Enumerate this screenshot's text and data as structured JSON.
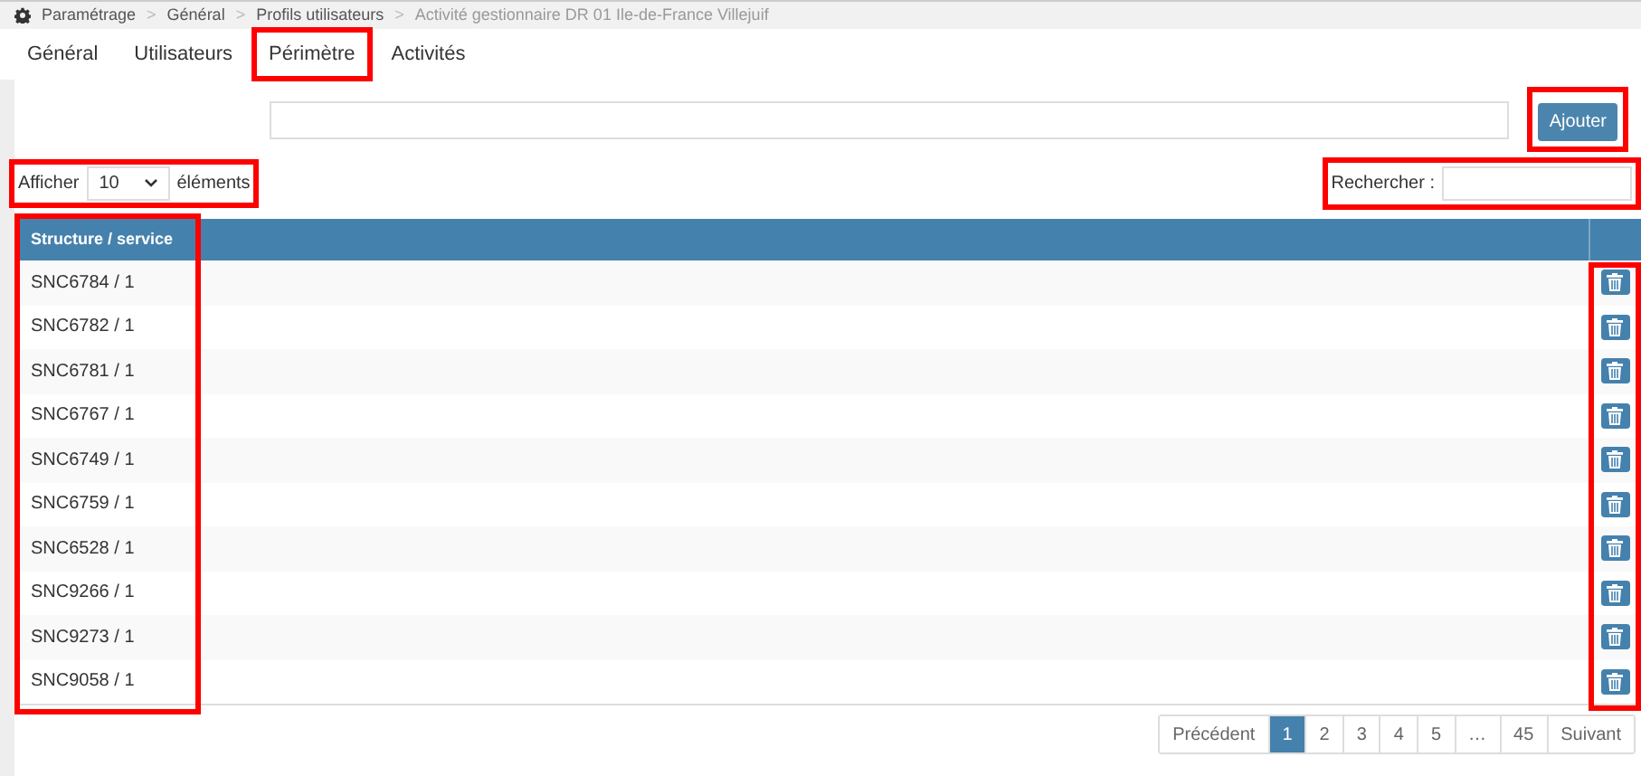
{
  "breadcrumb_separator": ">",
  "breadcrumb": [
    {
      "label": "Paramétrage",
      "kind": "root"
    },
    {
      "label": "Général",
      "kind": "link"
    },
    {
      "label": "Profils utilisateurs",
      "kind": "link"
    },
    {
      "label": "Activité gestionnaire DR 01 Ile-de-France Villejuif",
      "kind": "current"
    }
  ],
  "tabs": [
    {
      "label": "Général",
      "highlighted": false
    },
    {
      "label": "Utilisateurs",
      "highlighted": false
    },
    {
      "label": "Périmètre",
      "highlighted": true
    },
    {
      "label": "Activités",
      "highlighted": false
    }
  ],
  "add": {
    "button": "Ajouter",
    "highlighted": true
  },
  "length": {
    "prefix": "Afficher",
    "value": "10",
    "suffix": "éléments",
    "highlighted": true
  },
  "search": {
    "label": "Rechercher :",
    "highlighted": true
  },
  "table": {
    "columns": [
      {
        "label": "Structure / service",
        "highlighted": true
      },
      {
        "highlighted": true
      }
    ],
    "rows": [
      {
        "structure": "SNC6784 / 1"
      },
      {
        "structure": "SNC6782 / 1"
      },
      {
        "structure": "SNC6781 / 1"
      },
      {
        "structure": "SNC6767 / 1"
      },
      {
        "structure": "SNC6749 / 1"
      },
      {
        "structure": "SNC6759 / 1"
      },
      {
        "structure": "SNC6528 / 1"
      },
      {
        "structure": "SNC9266 / 1"
      },
      {
        "structure": "SNC9273 / 1"
      },
      {
        "structure": "SNC9058 / 1"
      }
    ]
  },
  "pagination": [
    {
      "label": "Précédent",
      "selected": false
    },
    {
      "label": "1",
      "selected": true
    },
    {
      "label": "2",
      "selected": false
    },
    {
      "label": "3",
      "selected": false
    },
    {
      "label": "4",
      "selected": false
    },
    {
      "label": "5",
      "selected": false
    },
    {
      "label": "…",
      "selected": false
    },
    {
      "label": "45",
      "selected": false
    },
    {
      "label": "Suivant",
      "selected": false
    }
  ]
}
